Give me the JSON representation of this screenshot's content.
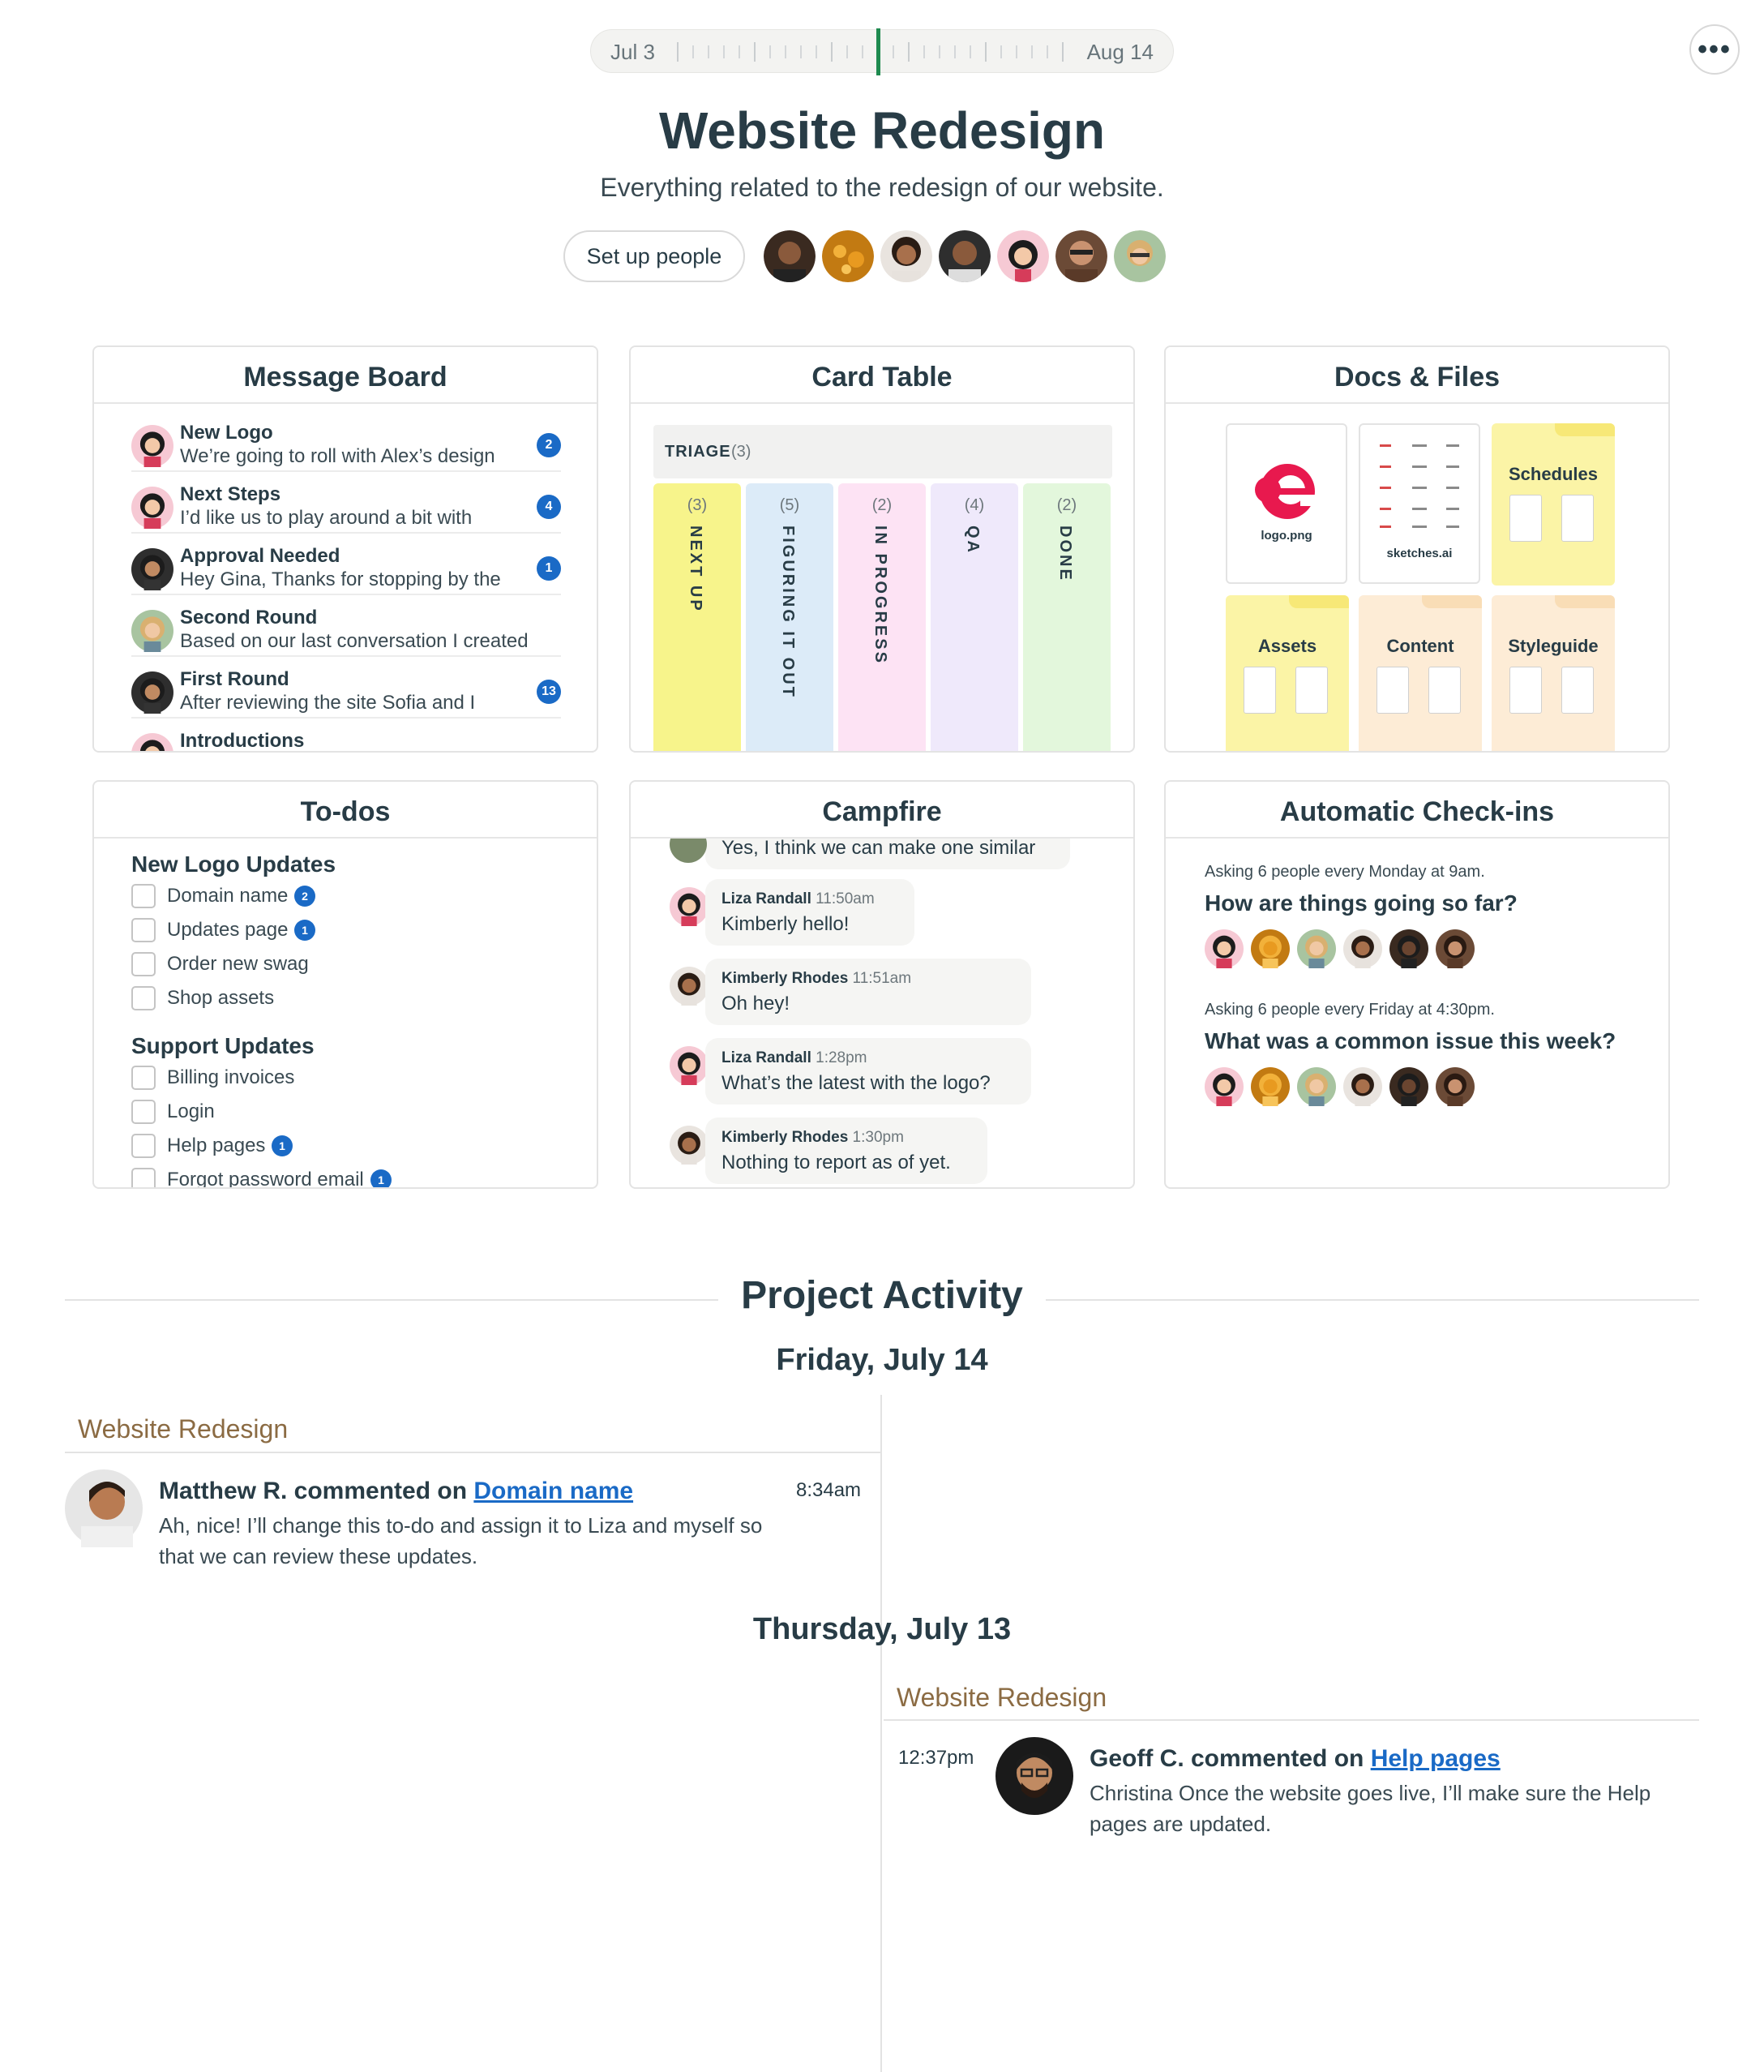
{
  "timeline": {
    "start": "Jul 3",
    "end": "Aug 14"
  },
  "project": {
    "title": "Website Redesign",
    "description": "Everything related to the redesign of our website.",
    "setup_people": "Set up people"
  },
  "message_board": {
    "title": "Message Board",
    "messages": [
      {
        "title": "New Logo",
        "preview": "We’re going to roll with Alex’s design",
        "count": "2"
      },
      {
        "title": "Next Steps",
        "preview": "I’d like us to play around a bit with",
        "count": "4"
      },
      {
        "title": "Approval Needed",
        "preview": "Hey Gina, Thanks for stopping by the",
        "count": "1"
      },
      {
        "title": "Second Round",
        "preview": "Based on our last conversation I created",
        "count": ""
      },
      {
        "title": "First Round",
        "preview": "After reviewing the site Sofia and I",
        "count": "13"
      },
      {
        "title": "Introductions",
        "preview": "",
        "count": ""
      }
    ]
  },
  "card_table": {
    "title": "Card Table",
    "triage_label": "TRIAGE",
    "triage_count": "(3)",
    "columns": [
      {
        "name": "NEXT UP",
        "count": "(3)",
        "color": "#f7f48b"
      },
      {
        "name": "FIGURING IT OUT",
        "count": "(5)",
        "color": "#dcebf8"
      },
      {
        "name": "IN PROGRESS",
        "count": "(2)",
        "color": "#fde3f4"
      },
      {
        "name": "QA",
        "count": "(4)",
        "color": "#efe9fb"
      },
      {
        "name": "DONE",
        "count": "(2)",
        "color": "#e3f7dc"
      }
    ]
  },
  "docs": {
    "title": "Docs & Files",
    "files": [
      {
        "name": "logo.png"
      },
      {
        "name": "sketches.ai"
      }
    ],
    "folders": [
      {
        "name": "Schedules",
        "color": "#fbf4a6",
        "tab": "#f7e877"
      },
      {
        "name": "Assets",
        "color": "#fbf4a6",
        "tab": "#f7e877"
      },
      {
        "name": "Content",
        "color": "#fdecd6",
        "tab": "#f9ddb6"
      },
      {
        "name": "Styleguide",
        "color": "#fdecd6",
        "tab": "#f9ddb6"
      }
    ]
  },
  "todos": {
    "title": "To-dos",
    "groups": [
      {
        "name": "New Logo Updates",
        "items": [
          {
            "label": "Domain name",
            "count": "2"
          },
          {
            "label": "Updates page",
            "count": "1"
          },
          {
            "label": "Order new swag",
            "count": ""
          },
          {
            "label": "Shop assets",
            "count": ""
          }
        ]
      },
      {
        "name": "Support Updates",
        "items": [
          {
            "label": "Billing invoices",
            "count": ""
          },
          {
            "label": "Login",
            "count": ""
          },
          {
            "label": "Help pages",
            "count": "1"
          },
          {
            "label": "Forgot password email",
            "count": "1"
          }
        ]
      }
    ]
  },
  "campfire": {
    "title": "Campfire",
    "top_line": "Yes, I think we can make one similar",
    "lines": [
      {
        "name": "Liza Randall",
        "time": "11:50am",
        "text": "Kimberly hello!"
      },
      {
        "name": "Kimberly Rhodes",
        "time": "11:51am",
        "text": "Oh hey!"
      },
      {
        "name": "Liza Randall",
        "time": "1:28pm",
        "text": "What’s the latest with the logo?"
      },
      {
        "name": "Kimberly Rhodes",
        "time": "1:30pm",
        "text": "Nothing to report as of yet."
      }
    ]
  },
  "checkins": {
    "title": "Automatic Check-ins",
    "questions": [
      {
        "asking": "Asking 6 people every Monday at 9am.",
        "question": "How are things going so far?"
      },
      {
        "asking": "Asking 6 people every Friday at 4:30pm.",
        "question": "What was a common issue this week?"
      }
    ]
  },
  "activity": {
    "title": "Project Activity",
    "days": [
      {
        "label": "Friday, July 14",
        "bucket": "Website Redesign",
        "author_action": "Matthew R. commented on ",
        "link": "Domain name",
        "time": "8:34am",
        "body": "Ah, nice! I’ll change this to-do and assign it to Liza and myself so that we can review these updates."
      },
      {
        "label": "Thursday, July 13",
        "bucket": "Website Redesign",
        "author_action": "Geoff C. commented on ",
        "link": "Help pages",
        "time": "12:37pm",
        "body": "Christina Once the website goes live, I’ll make sure the Help pages are updated."
      }
    ]
  },
  "colors": {
    "accent_link": "#1a6ac6",
    "timeline_now": "#1e8a4f",
    "bucket": "#8b6b43"
  }
}
